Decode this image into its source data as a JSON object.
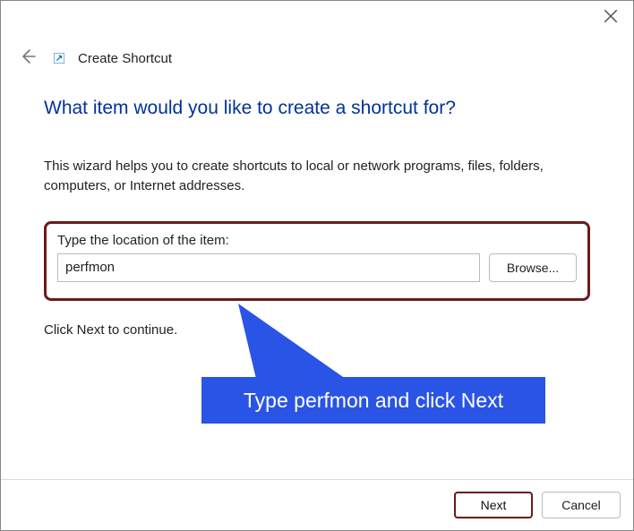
{
  "window": {
    "title": "Create Shortcut"
  },
  "wizard": {
    "heading": "What item would you like to create a shortcut for?",
    "description": "This wizard helps you to create shortcuts to local or network programs, files, folders, computers, or Internet addresses.",
    "location_label": "Type the location of the item:",
    "location_value": "perfmon",
    "browse_label": "Browse...",
    "continue_hint": "Click Next to continue."
  },
  "annotation": {
    "text": "Type perfmon and click Next",
    "color": "#2a54e5"
  },
  "footer": {
    "next_label": "Next",
    "cancel_label": "Cancel"
  }
}
